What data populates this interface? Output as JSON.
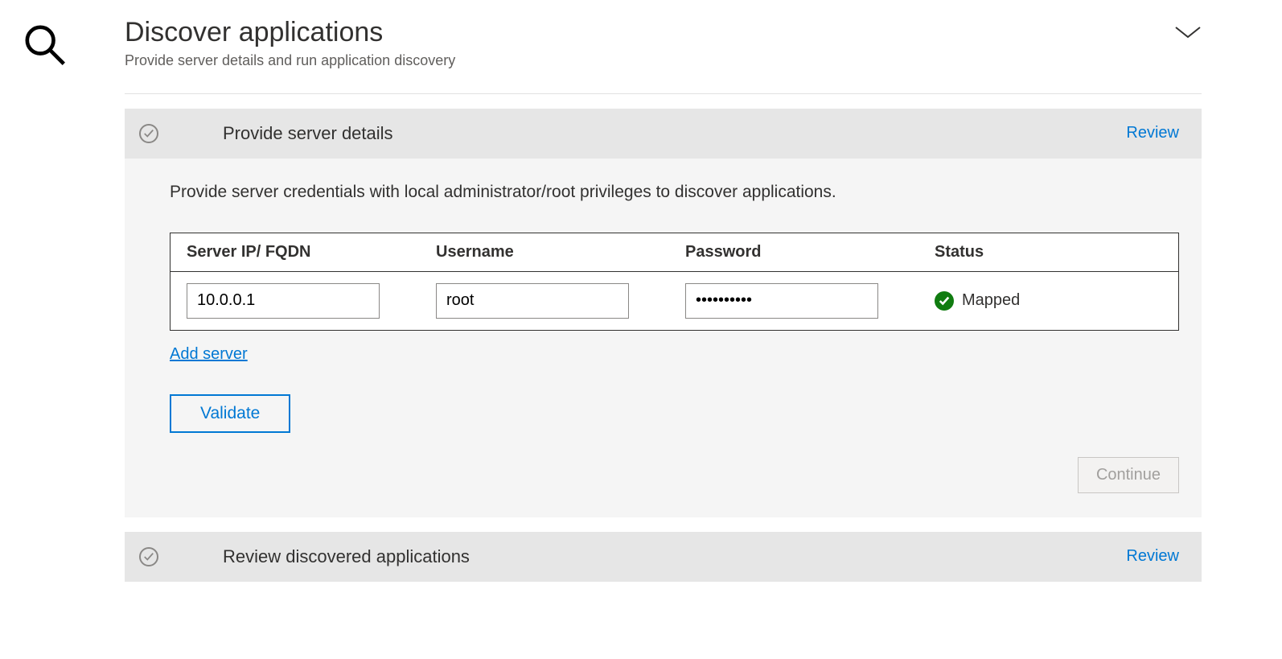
{
  "header": {
    "title": "Discover applications",
    "subtitle": "Provide server details and run application discovery"
  },
  "section1": {
    "title": "Provide server details",
    "review_label": "Review",
    "instruction": "Provide server credentials with local administrator/root privileges to discover applications.",
    "columns": {
      "ip": "Server IP/ FQDN",
      "user": "Username",
      "pass": "Password",
      "status": "Status"
    },
    "rows": [
      {
        "ip": "10.0.0.1",
        "user": "root",
        "password_mask": "••••••••••",
        "status_text": "Mapped"
      }
    ],
    "add_server_label": "Add server",
    "validate_label": "Validate",
    "continue_label": "Continue"
  },
  "section2": {
    "title": "Review discovered applications",
    "review_label": "Review"
  }
}
